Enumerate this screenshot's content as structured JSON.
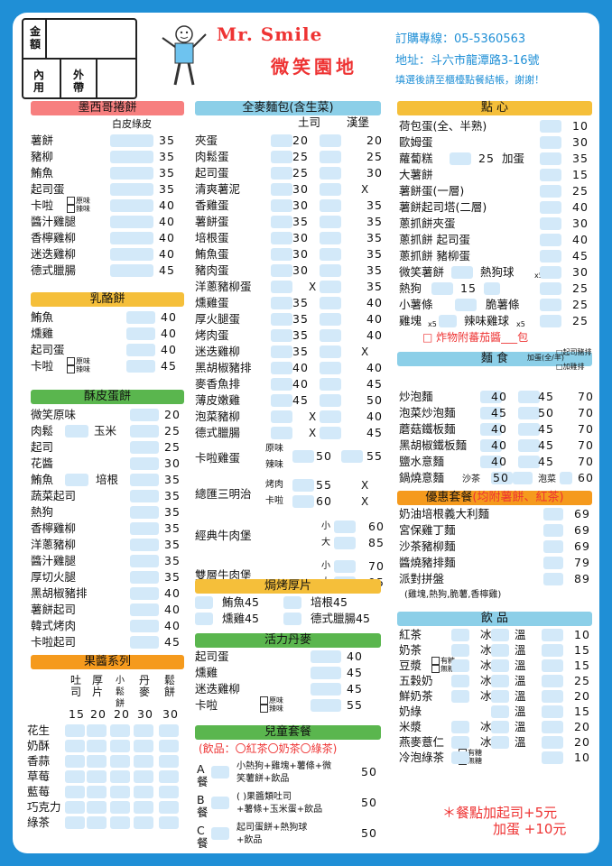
{
  "header": {
    "order_box": {
      "amount": "金額",
      "dine_in": "內用",
      "takeout": "外帶"
    },
    "brand": "Mr. Smile",
    "brand_cn": "微笑園地",
    "phone": "訂購專線：05-5360563",
    "address": "地址：斗六市龍潭路3-16號",
    "note": "填選後請至櫃檯點餐結帳，謝謝！"
  },
  "mexican": {
    "title": "墨西哥捲餅",
    "sub": "白皮綠皮",
    "items": [
      [
        "薯餅",
        "35"
      ],
      [
        "豬柳",
        "35"
      ],
      [
        "鮪魚",
        "35"
      ],
      [
        "起司蛋",
        "35"
      ],
      [
        "卡啦",
        "40"
      ],
      [
        "醬汁雞腿",
        "40"
      ],
      [
        "香檸雞柳",
        "40"
      ],
      [
        "迷迭雞柳",
        "40"
      ],
      [
        "德式臘腸",
        "45"
      ]
    ],
    "opt1": "原味",
    "opt2": "辣味"
  },
  "cheese": {
    "title": "乳酪餅",
    "items": [
      [
        "鮪魚",
        "40"
      ],
      [
        "燻雞",
        "40"
      ],
      [
        "起司蛋",
        "40"
      ],
      [
        "卡啦",
        "45"
      ]
    ],
    "opt1": "原味",
    "opt2": "辣味"
  },
  "crispy": {
    "title": "酥皮蛋餅",
    "items": [
      [
        "微笑原味",
        "20"
      ],
      [
        "肉鬆",
        "25"
      ],
      [
        "起司",
        "25"
      ],
      [
        "花醬",
        "30"
      ],
      [
        "鮪魚",
        "35"
      ],
      [
        "蔬菜起司",
        "35"
      ],
      [
        "熱狗",
        "35"
      ],
      [
        "香檸雞柳",
        "35"
      ],
      [
        "洋蔥豬柳",
        "35"
      ],
      [
        "醬汁雞腿",
        "35"
      ],
      [
        "厚切火腿",
        "35"
      ],
      [
        "黑胡椒豬排",
        "40"
      ],
      [
        "薯餅起司",
        "40"
      ],
      [
        "韓式烤肉",
        "40"
      ],
      [
        "卡啦起司",
        "45"
      ]
    ],
    "extra1": "玉米",
    "extra2": "培根"
  },
  "jam": {
    "title": "果醬系列",
    "cols": [
      "吐司",
      "厚片",
      "小鬆餅",
      "丹麥",
      "鬆餅"
    ],
    "prices": [
      "15",
      "20",
      "20",
      "30",
      "30"
    ],
    "items": [
      "花生",
      "奶酥",
      "香蒜",
      "草莓",
      "藍莓",
      "巧克力",
      "綠茶"
    ]
  },
  "bread": {
    "title": "全麥麵包(含生菜)",
    "col1": "土司",
    "col2": "漢堡",
    "items": [
      [
        "夾蛋",
        "20",
        "20"
      ],
      [
        "肉鬆蛋",
        "25",
        "25"
      ],
      [
        "起司蛋",
        "25",
        "30"
      ],
      [
        "清爽薯泥",
        "30",
        "X"
      ],
      [
        "香雞蛋",
        "30",
        "35"
      ],
      [
        "薯餅蛋",
        "35",
        "35"
      ],
      [
        "培根蛋",
        "30",
        "35"
      ],
      [
        "鮪魚蛋",
        "30",
        "35"
      ],
      [
        "豬肉蛋",
        "30",
        "35"
      ],
      [
        "洋蔥豬柳蛋",
        "X",
        "35"
      ],
      [
        "燻雞蛋",
        "35",
        "40"
      ],
      [
        "厚火腿蛋",
        "35",
        "40"
      ],
      [
        "烤肉蛋",
        "35",
        "40"
      ],
      [
        "迷迭雞柳",
        "35",
        "X"
      ],
      [
        "黑胡椒豬排",
        "40",
        "40"
      ],
      [
        "麥香魚排",
        "40",
        "45"
      ],
      [
        "薄皮嫩雞",
        "45",
        "50"
      ],
      [
        "泡菜豬柳",
        "X",
        "40"
      ],
      [
        "德式臘腸",
        "X",
        "45"
      ]
    ],
    "karaage": {
      "name": "卡啦雞蛋",
      "opt1": "原味",
      "opt2": "辣味",
      "p1": "50",
      "p2": "55"
    },
    "club": {
      "name": "總匯三明治",
      "opt1": "烤肉",
      "opt2": "卡啦",
      "r1": [
        "55",
        "X"
      ],
      "r2": [
        "60",
        "X"
      ]
    },
    "beef1": {
      "name": "經典牛肉堡",
      "s": "小",
      "l": "大",
      "ps": "60",
      "pl": "85"
    },
    "beef2": {
      "name": "雙層牛肉堡",
      "s": "小",
      "l": "大",
      "ps": "70",
      "pl": "95"
    }
  },
  "grill": {
    "title": "焗烤厚片",
    "items": [
      [
        "鮪魚",
        "45"
      ],
      [
        "培根",
        "45"
      ],
      [
        "燻雞",
        "45"
      ],
      [
        "德式臘腸",
        "45"
      ]
    ]
  },
  "danish": {
    "title": "活力丹麥",
    "items": [
      [
        "起司蛋",
        "40"
      ],
      [
        "燻雞",
        "45"
      ],
      [
        "迷迭雞柳",
        "45"
      ],
      [
        "卡啦",
        "55"
      ]
    ],
    "opt1": "原味",
    "opt2": "辣味"
  },
  "kids": {
    "title": "兒童套餐",
    "drinks": "(飲品：〇紅茶〇奶茶〇綠茶)",
    "a": {
      "label": "A餐",
      "desc1": "小熱狗+雞塊+薯條+微",
      "desc2": "笑薯餅+飲品",
      "price": "50"
    },
    "b": {
      "label": "B餐",
      "desc1": "(        )果醬類吐司",
      "desc2": "+薯條+玉米蛋+飲品",
      "price": "50"
    },
    "c": {
      "label": "C餐",
      "desc1": "起司蛋餅+熱狗球",
      "desc2": "+飲品",
      "price": "50"
    }
  },
  "snack": {
    "title": "點 心",
    "items": [
      [
        "荷包蛋(全、半熟)",
        "10"
      ],
      [
        "歐姆蛋",
        "30"
      ],
      [
        "蘿蔔糕",
        "35"
      ],
      [
        "大薯餅",
        "15"
      ],
      [
        "薯餅蛋(一層)",
        "25"
      ],
      [
        "薯餅起司塔(二層)",
        "40"
      ],
      [
        "蔥抓餅夾蛋",
        "30"
      ],
      [
        "蔥抓餅 起司蛋",
        "40"
      ],
      [
        "蔥抓餅 豬柳蛋",
        "45"
      ],
      [
        "微笑薯餅",
        "30"
      ],
      [
        "熱狗",
        "25"
      ],
      [
        "小薯條",
        "25"
      ],
      [
        "雞塊",
        "25"
      ]
    ],
    "radish_extra": "25",
    "egg_add": "加蛋",
    "nugget": "熱狗球",
    "nugget_n": "x5",
    "crisp": "脆薯條",
    "hotdog_n": "15",
    "spicy": "辣味雞球",
    "spicy_n": "x5",
    "ketchup": "炸物附蕃茄醬___包"
  },
  "noodle": {
    "title": "麵 食",
    "h1": "加蛋(全/半)",
    "h2": "起司豬排",
    "h3": "加雞排",
    "items": [
      [
        "炒泡麵",
        "40",
        "45",
        "70"
      ],
      [
        "泡菜炒泡麵",
        "45",
        "50",
        "70"
      ],
      [
        "蘑菇鐵板麵",
        "40",
        "45",
        "70"
      ],
      [
        "黑胡椒鐵板麵",
        "40",
        "45",
        "70"
      ],
      [
        "鹽水意麵",
        "40",
        "45",
        "70"
      ],
      [
        "鍋燒意麵",
        "沙茶",
        "50",
        "泡菜",
        "60"
      ]
    ]
  },
  "combo": {
    "title": "優惠套餐",
    "title_red": "(均附薯餅、紅茶)",
    "items": [
      [
        "奶油培根義大利麵",
        "69"
      ],
      [
        "宮保雞丁麵",
        "69"
      ],
      [
        "沙茶豬柳麵",
        "69"
      ],
      [
        "醬燒豬排麵",
        "79"
      ],
      [
        "派對拼盤",
        "89"
      ]
    ],
    "note": "(雞塊,熱狗,脆薯,香檸雞)"
  },
  "drink": {
    "title": "飲 品",
    "ice": "冰",
    "warm": "溫",
    "items": [
      [
        "紅茶",
        "10"
      ],
      [
        "奶茶",
        "15"
      ],
      [
        "豆漿",
        "15"
      ],
      [
        "五穀奶",
        "25"
      ],
      [
        "鮮奶茶",
        "20"
      ],
      [
        "奶綠",
        "15"
      ],
      [
        "米漿",
        "20"
      ],
      [
        "燕麥薏仁",
        "20"
      ],
      [
        "冷泡綠茶",
        "10"
      ]
    ],
    "sugar1": "有糖",
    "sugar2": "無糖"
  },
  "footer": {
    "line1": "＊餐點加起司+5元",
    "line2": "加蛋 +10元"
  },
  "colors": {
    "bg": "#1f8fd6",
    "box": "#d3e9f9",
    "red": "#e33"
  }
}
